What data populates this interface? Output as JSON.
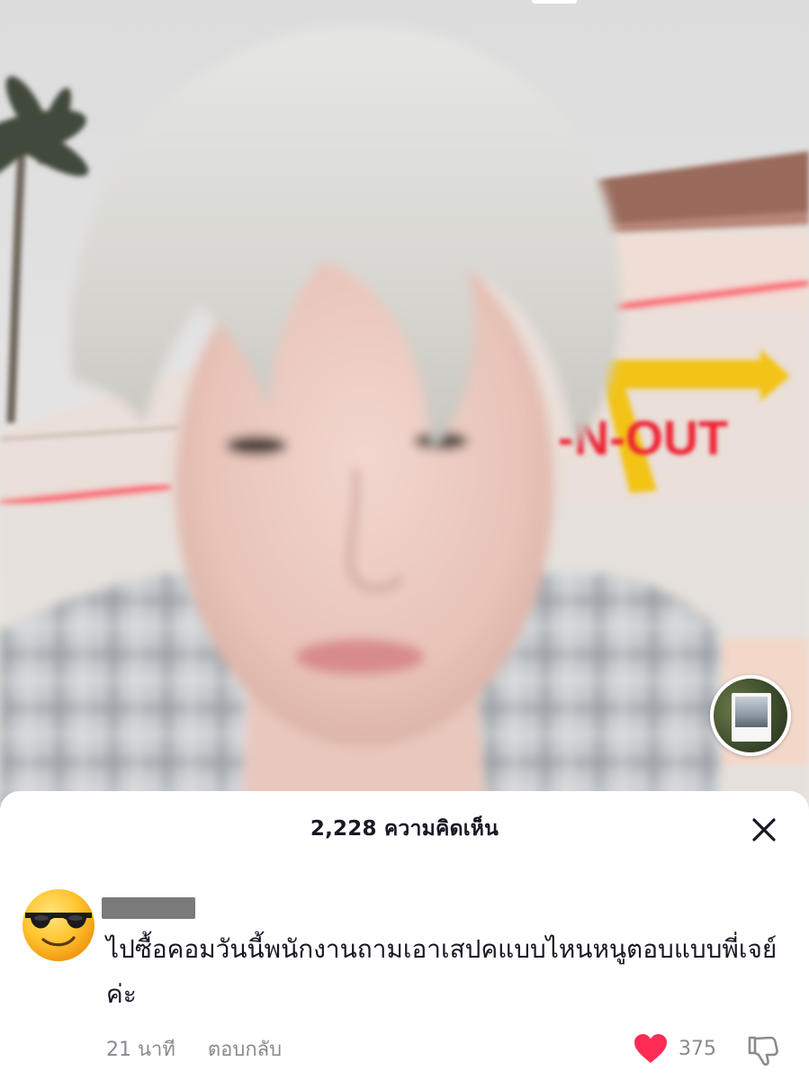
{
  "video": {
    "sign_text": "-N-OUT",
    "icons": {
      "music_disc": "music-disc-thumbnail"
    }
  },
  "comments_panel": {
    "count_label": "2,228 ความคิดเห็น",
    "close_icon": "close-icon"
  },
  "comment": {
    "avatar": "sunglasses-emoji-avatar",
    "text": "ไปซื้อคอมวันนี้พนักงานถามเอาเสปคแบบไหนหนูตอบแบบพี่เจย์ค่ะ",
    "time": "21 นาที",
    "reply_label": "ตอบกลับ",
    "like_count": "375",
    "liked": true,
    "icons": {
      "like": "heart-icon",
      "dislike": "thumbs-down-icon"
    },
    "colors": {
      "like": "#fe2c55",
      "muted": "#8a8b91"
    }
  }
}
